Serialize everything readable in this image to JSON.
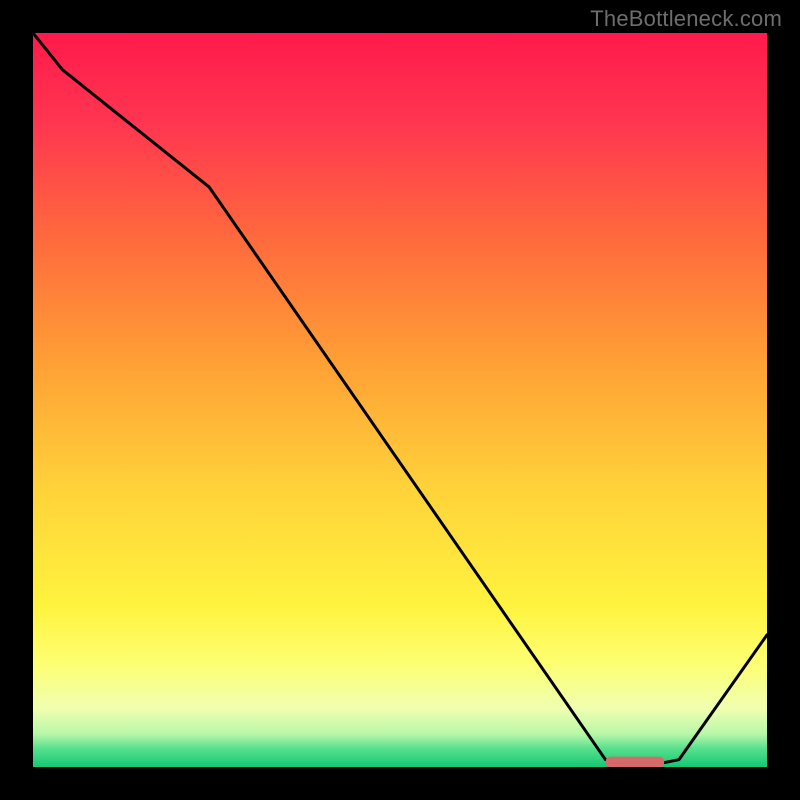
{
  "watermark": "TheBottleneck.com",
  "chart_data": {
    "type": "line",
    "title": "",
    "xlabel": "",
    "ylabel": "",
    "x_range": [
      0,
      100
    ],
    "y_range": [
      0,
      100
    ],
    "x": [
      0,
      4,
      24,
      78,
      83,
      88,
      100
    ],
    "values": [
      100,
      95,
      79,
      1,
      0,
      1,
      18
    ],
    "marker": {
      "x_start": 78,
      "x_end": 86,
      "y": 0.6,
      "color": "#d66a6a"
    },
    "background_gradient": {
      "stops": [
        {
          "offset": 0.0,
          "color": "#ff1a4b"
        },
        {
          "offset": 0.12,
          "color": "#ff3550"
        },
        {
          "offset": 0.28,
          "color": "#ff6a3d"
        },
        {
          "offset": 0.45,
          "color": "#ffa035"
        },
        {
          "offset": 0.62,
          "color": "#ffd23a"
        },
        {
          "offset": 0.78,
          "color": "#fff33e"
        },
        {
          "offset": 0.86,
          "color": "#fdff72"
        },
        {
          "offset": 0.92,
          "color": "#f0ffb0"
        },
        {
          "offset": 0.955,
          "color": "#b8f7a8"
        },
        {
          "offset": 0.975,
          "color": "#57e08e"
        },
        {
          "offset": 1.0,
          "color": "#14c873"
        }
      ]
    }
  }
}
